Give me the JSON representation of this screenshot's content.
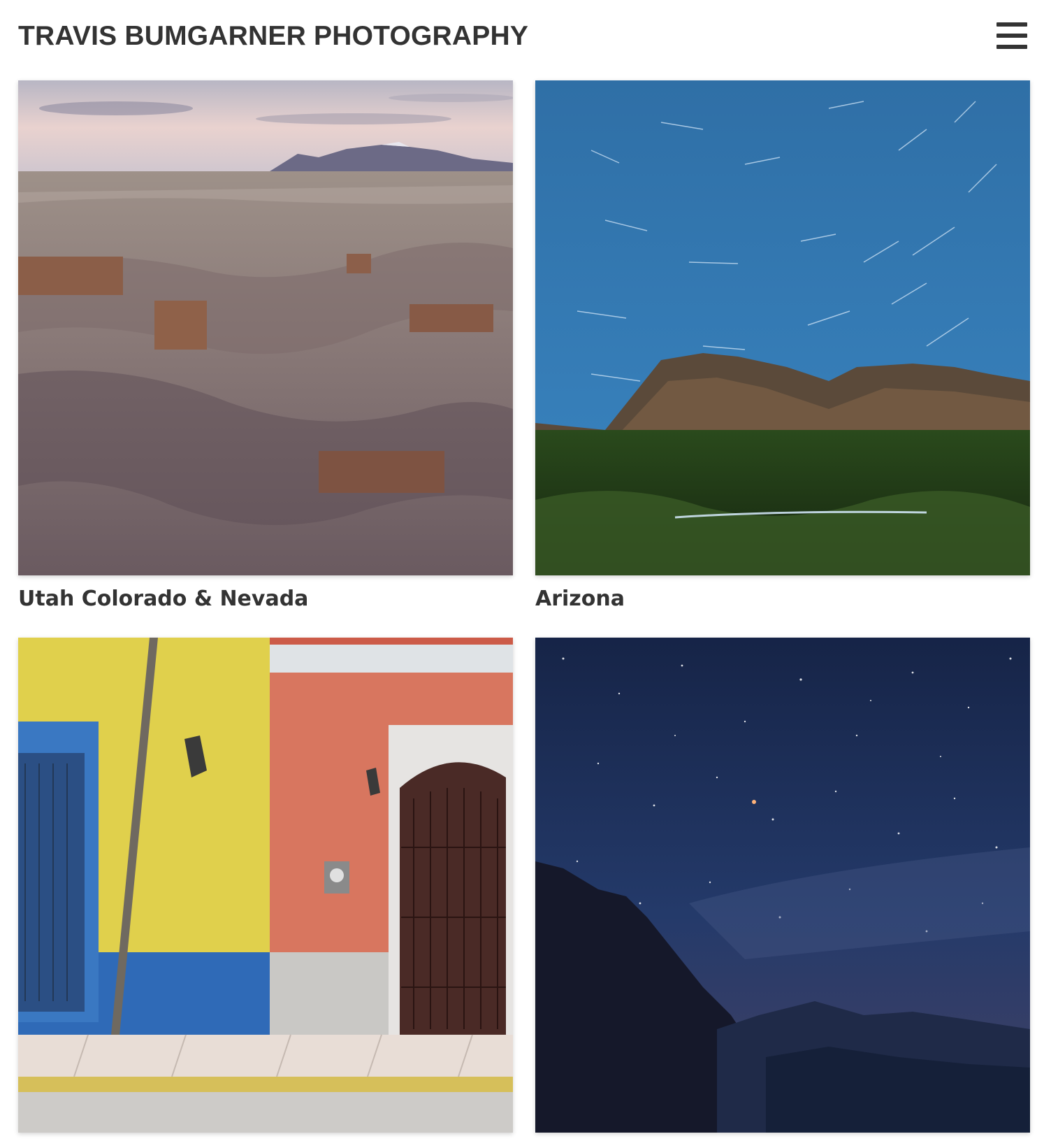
{
  "header": {
    "site_title": "TRAVIS BUMGARNER PHOTOGRAPHY",
    "menu_icon": "hamburger-menu-icon"
  },
  "gallery": {
    "items": [
      {
        "caption": "Utah Colorado & Nevada",
        "image": "badlands-desert-canyon"
      },
      {
        "caption": "Arizona",
        "image": "star-trails-over-mountain"
      },
      {
        "caption": "",
        "image": "colorful-street-facade"
      },
      {
        "caption": "",
        "image": "starry-night-over-mountains"
      }
    ]
  },
  "colors": {
    "text": "#333333",
    "background": "#ffffff"
  }
}
